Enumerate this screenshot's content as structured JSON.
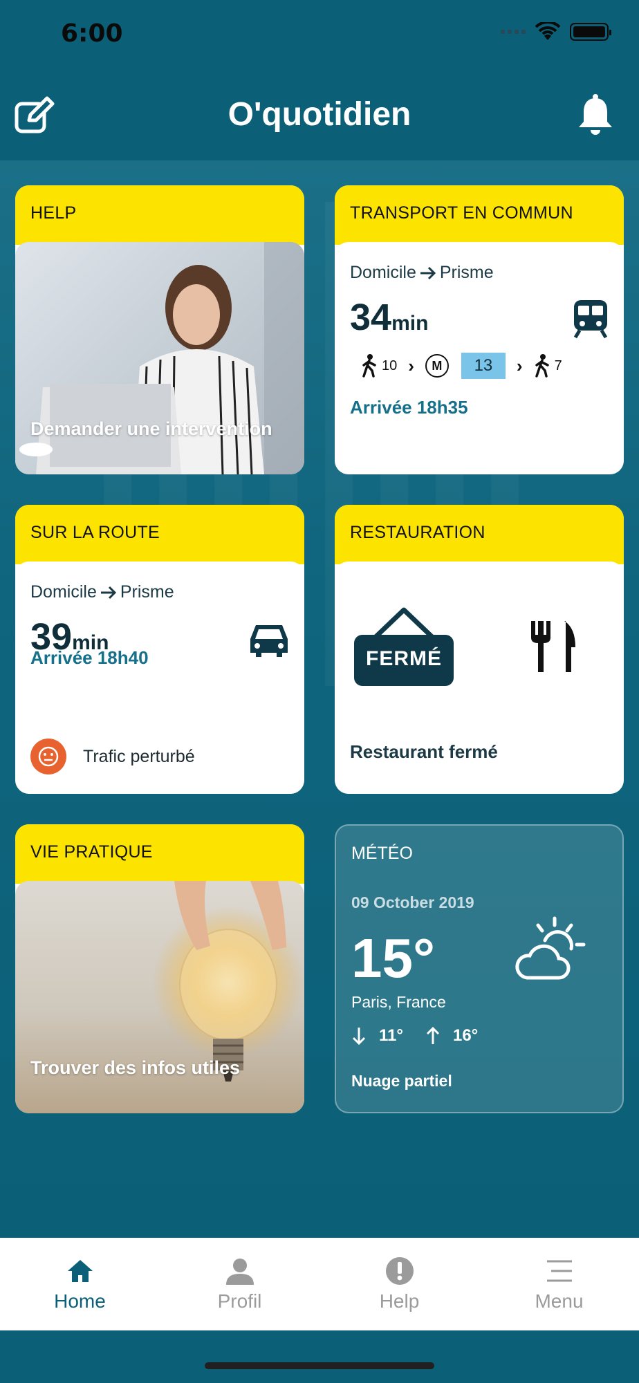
{
  "status": {
    "time": "6:00"
  },
  "header": {
    "title": "O'quotidien",
    "edit_icon": "edit-icon",
    "bell_icon": "bell-icon"
  },
  "cards": {
    "help": {
      "title": "HELP",
      "caption": "Demander une intervention"
    },
    "transport": {
      "title": "TRANSPORT EN COMMUN",
      "from": "Domicile",
      "to": "Prisme",
      "duration": "34",
      "unit": "min",
      "walk_start": "10",
      "metro_symbol": "M",
      "line": "13",
      "walk_end": "7",
      "arrival": "Arrivée 18h35"
    },
    "route": {
      "title": "SUR LA ROUTE",
      "from": "Domicile",
      "to": "Prisme",
      "duration": "39",
      "unit": "min",
      "arrival": "Arrivée 18h40",
      "traffic": "Trafic perturbé"
    },
    "resto": {
      "title": "RESTAURATION",
      "sign": "FERMÉ",
      "label": "Restaurant fermé"
    },
    "vie": {
      "title": "VIE PRATIQUE",
      "caption": "Trouver des infos utiles"
    },
    "meteo": {
      "title": "MÉTÉO",
      "date": "09 October 2019",
      "temp": "15°",
      "location": "Paris, France",
      "min": "11°",
      "max": "16°",
      "description": "Nuage partiel"
    }
  },
  "tabs": [
    {
      "label": "Home",
      "icon": "home-icon",
      "active": true
    },
    {
      "label": "Profil",
      "icon": "person-icon",
      "active": false
    },
    {
      "label": "Help",
      "icon": "alert-icon",
      "active": false
    },
    {
      "label": "Menu",
      "icon": "menu-icon",
      "active": false
    }
  ],
  "colors": {
    "primary": "#0b6078",
    "accent_yellow": "#fde400",
    "arrival_text": "#16708a",
    "metro_line": "#79c4e8",
    "traffic_warning": "#e8622f"
  }
}
